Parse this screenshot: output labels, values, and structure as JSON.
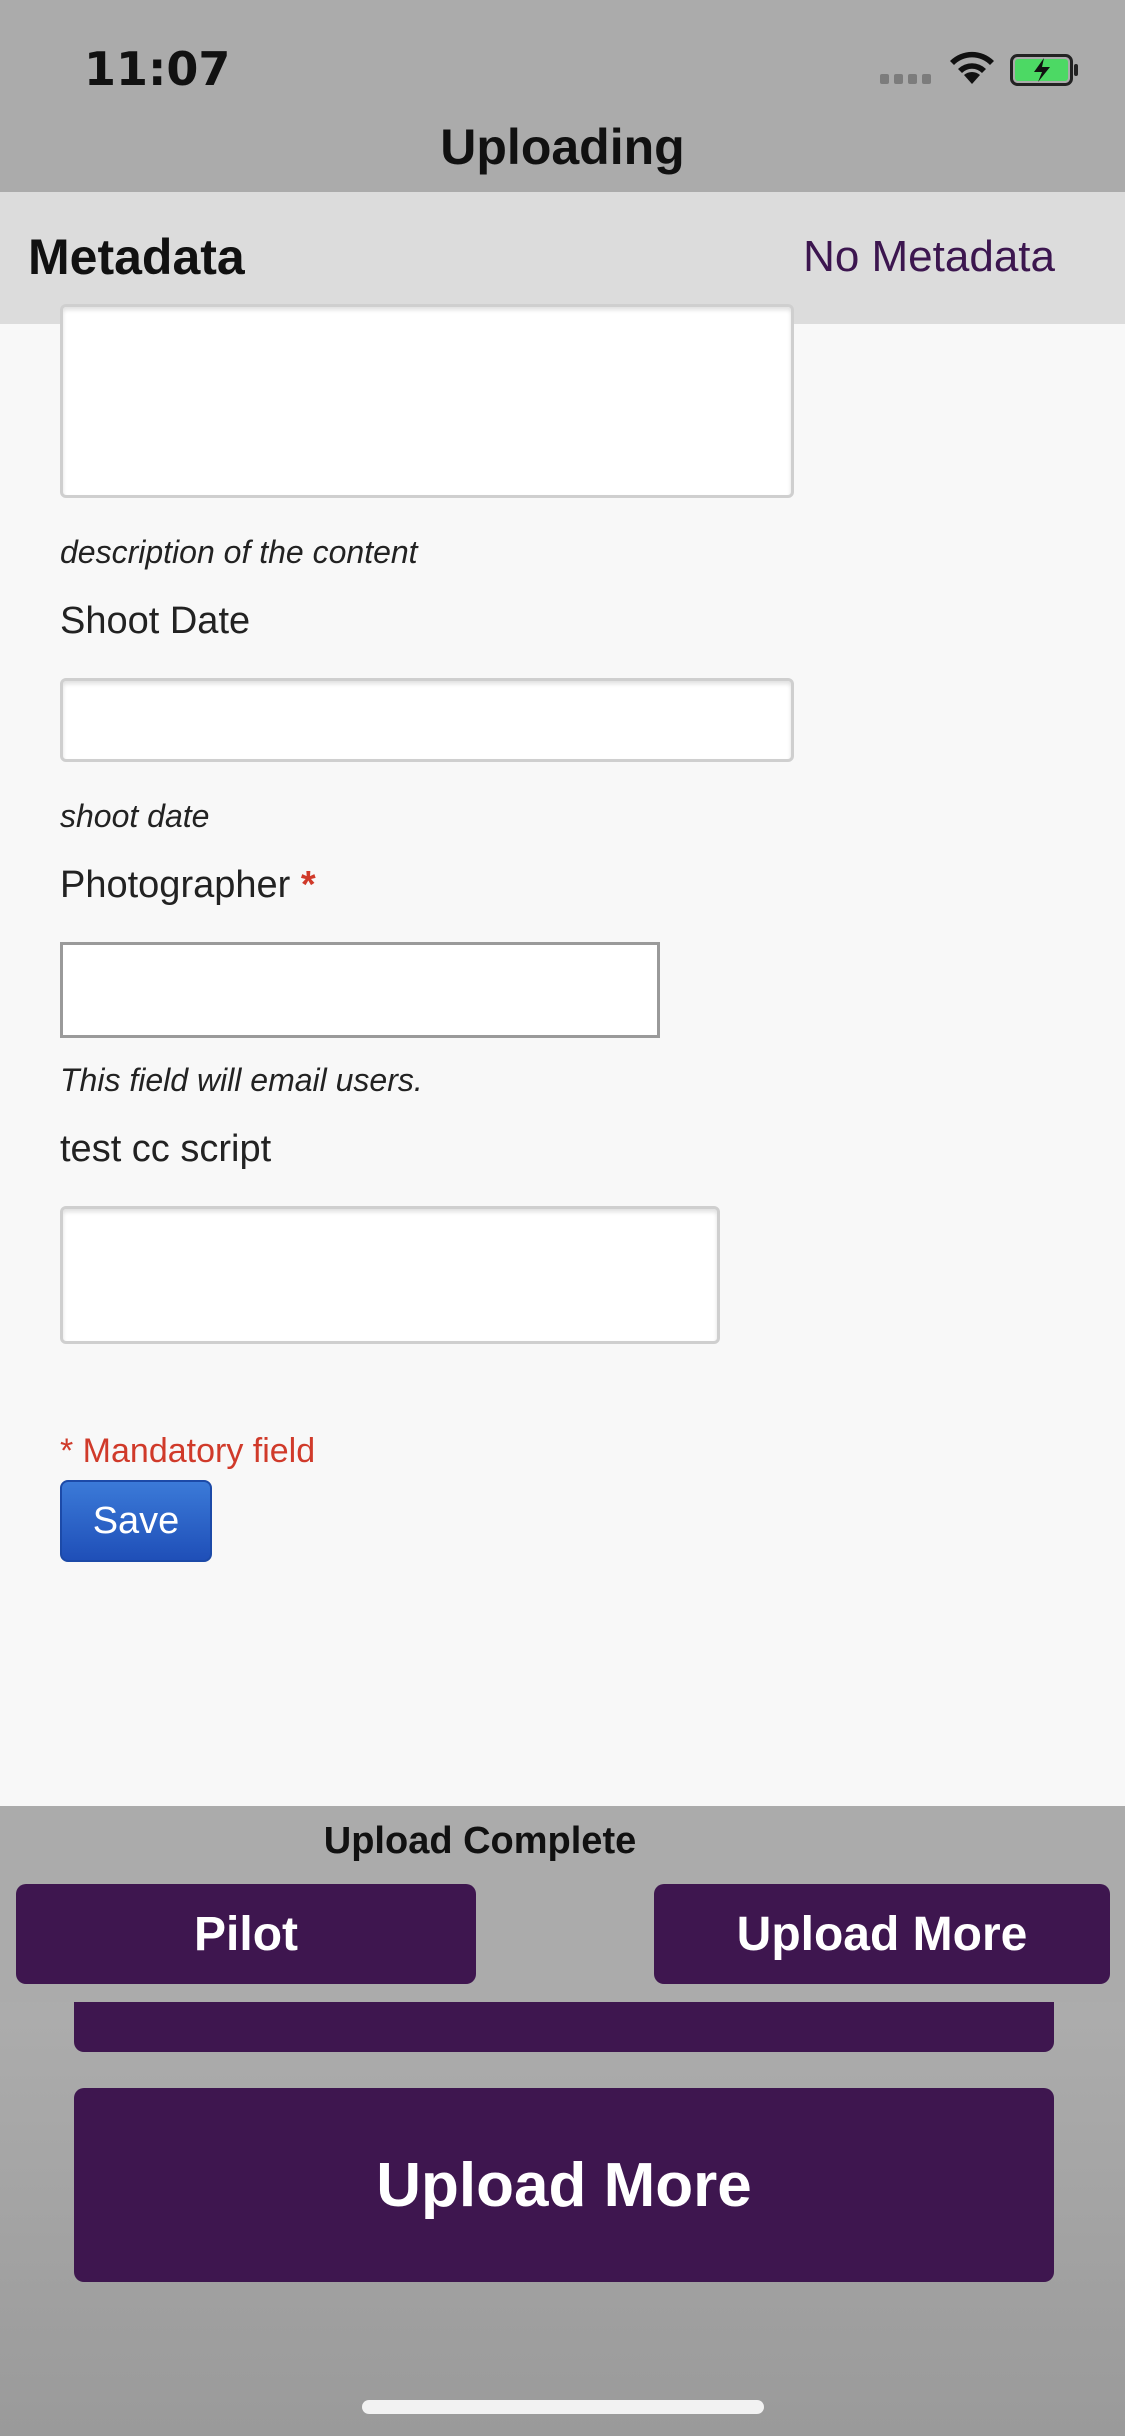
{
  "status_bar": {
    "time": "11:07",
    "icons": [
      "signal-dots-icon",
      "wifi-icon",
      "battery-charging-icon"
    ]
  },
  "nav": {
    "title": "Uploading"
  },
  "metadata_header": {
    "title": "Metadata",
    "link": "No Metadata"
  },
  "form": {
    "description_help": "description of the content",
    "shoot_date_label": "Shoot Date",
    "shoot_date_value": "",
    "shoot_date_help": "shoot date",
    "photographer_label": "Photographer",
    "photographer_required": "*",
    "photographer_value": "",
    "photographer_help": "This field will email users.",
    "cc_script_label": "test cc script",
    "cc_script_value": "",
    "mandatory_note": "* Mandatory field",
    "save_label": "Save"
  },
  "bottom": {
    "status": "Upload Complete",
    "pilot_label": "Pilot",
    "upload_more_label": "Upload More",
    "upload_more_big_label": "Upload More"
  },
  "colors": {
    "accent": "#3e164f",
    "required": "#d03a2a",
    "button_blue": "#1f4fb8"
  }
}
